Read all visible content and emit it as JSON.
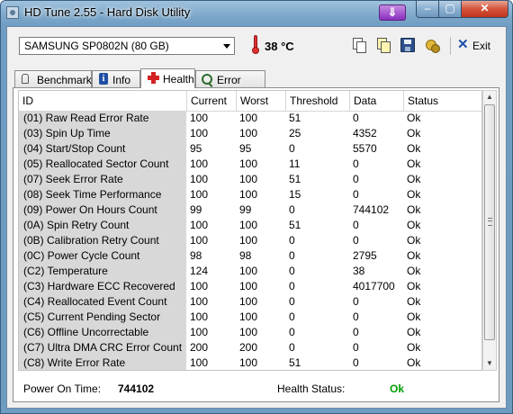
{
  "window": {
    "title": "HD Tune 2.55 - Hard Disk Utility",
    "close_glyph": "✕",
    "max_glyph": "▢",
    "min_glyph": "–",
    "download_glyph": "⇓"
  },
  "toolbar": {
    "drive": "SAMSUNG SP0802N (80 GB)",
    "temperature": "38 °C",
    "exit_label": "Exit",
    "icons": [
      "copy-icon",
      "copy-all-icon",
      "save-icon",
      "options-icon",
      "exit-icon"
    ]
  },
  "tabs": [
    {
      "label": "Benchmark",
      "icon": "bulb-icon"
    },
    {
      "label": "Info",
      "icon": "info-icon"
    },
    {
      "label": "Health",
      "icon": "health-cross-icon",
      "active": true
    },
    {
      "label": "Error Scan",
      "icon": "magnifier-icon"
    }
  ],
  "table": {
    "columns": [
      "ID",
      "Current",
      "Worst",
      "Threshold",
      "Data",
      "Status"
    ],
    "rows": [
      [
        "(01) Raw Read Error Rate",
        "100",
        "100",
        "51",
        "0",
        "Ok"
      ],
      [
        "(03) Spin Up Time",
        "100",
        "100",
        "25",
        "4352",
        "Ok"
      ],
      [
        "(04) Start/Stop Count",
        "95",
        "95",
        "0",
        "5570",
        "Ok"
      ],
      [
        "(05) Reallocated Sector Count",
        "100",
        "100",
        "11",
        "0",
        "Ok"
      ],
      [
        "(07) Seek Error Rate",
        "100",
        "100",
        "51",
        "0",
        "Ok"
      ],
      [
        "(08) Seek Time Performance",
        "100",
        "100",
        "15",
        "0",
        "Ok"
      ],
      [
        "(09) Power On Hours Count",
        "99",
        "99",
        "0",
        "744102",
        "Ok"
      ],
      [
        "(0A) Spin Retry Count",
        "100",
        "100",
        "51",
        "0",
        "Ok"
      ],
      [
        "(0B) Calibration Retry Count",
        "100",
        "100",
        "0",
        "0",
        "Ok"
      ],
      [
        "(0C) Power Cycle Count",
        "98",
        "98",
        "0",
        "2795",
        "Ok"
      ],
      [
        "(C2) Temperature",
        "124",
        "100",
        "0",
        "38",
        "Ok"
      ],
      [
        "(C3) Hardware ECC Recovered",
        "100",
        "100",
        "0",
        "4017700",
        "Ok"
      ],
      [
        "(C4) Reallocated Event Count",
        "100",
        "100",
        "0",
        "0",
        "Ok"
      ],
      [
        "(C5) Current Pending Sector",
        "100",
        "100",
        "0",
        "0",
        "Ok"
      ],
      [
        "(C6) Offline Uncorrectable",
        "100",
        "100",
        "0",
        "0",
        "Ok"
      ],
      [
        "(C7) Ultra DMA CRC Error Count",
        "200",
        "200",
        "0",
        "0",
        "Ok"
      ],
      [
        "(C8) Write Error Rate",
        "100",
        "100",
        "51",
        "0",
        "Ok"
      ]
    ]
  },
  "scrollbar": {
    "up_glyph": "▲",
    "down_glyph": "▼"
  },
  "footer": {
    "power_on_label": "Power On Time:",
    "power_on_value": "744102",
    "health_label": "Health Status:",
    "health_value": "Ok"
  },
  "colors": {
    "health_ok": "#00a000",
    "title_gradient_top": "#9fc2dd",
    "close_button": "#c2341d"
  }
}
